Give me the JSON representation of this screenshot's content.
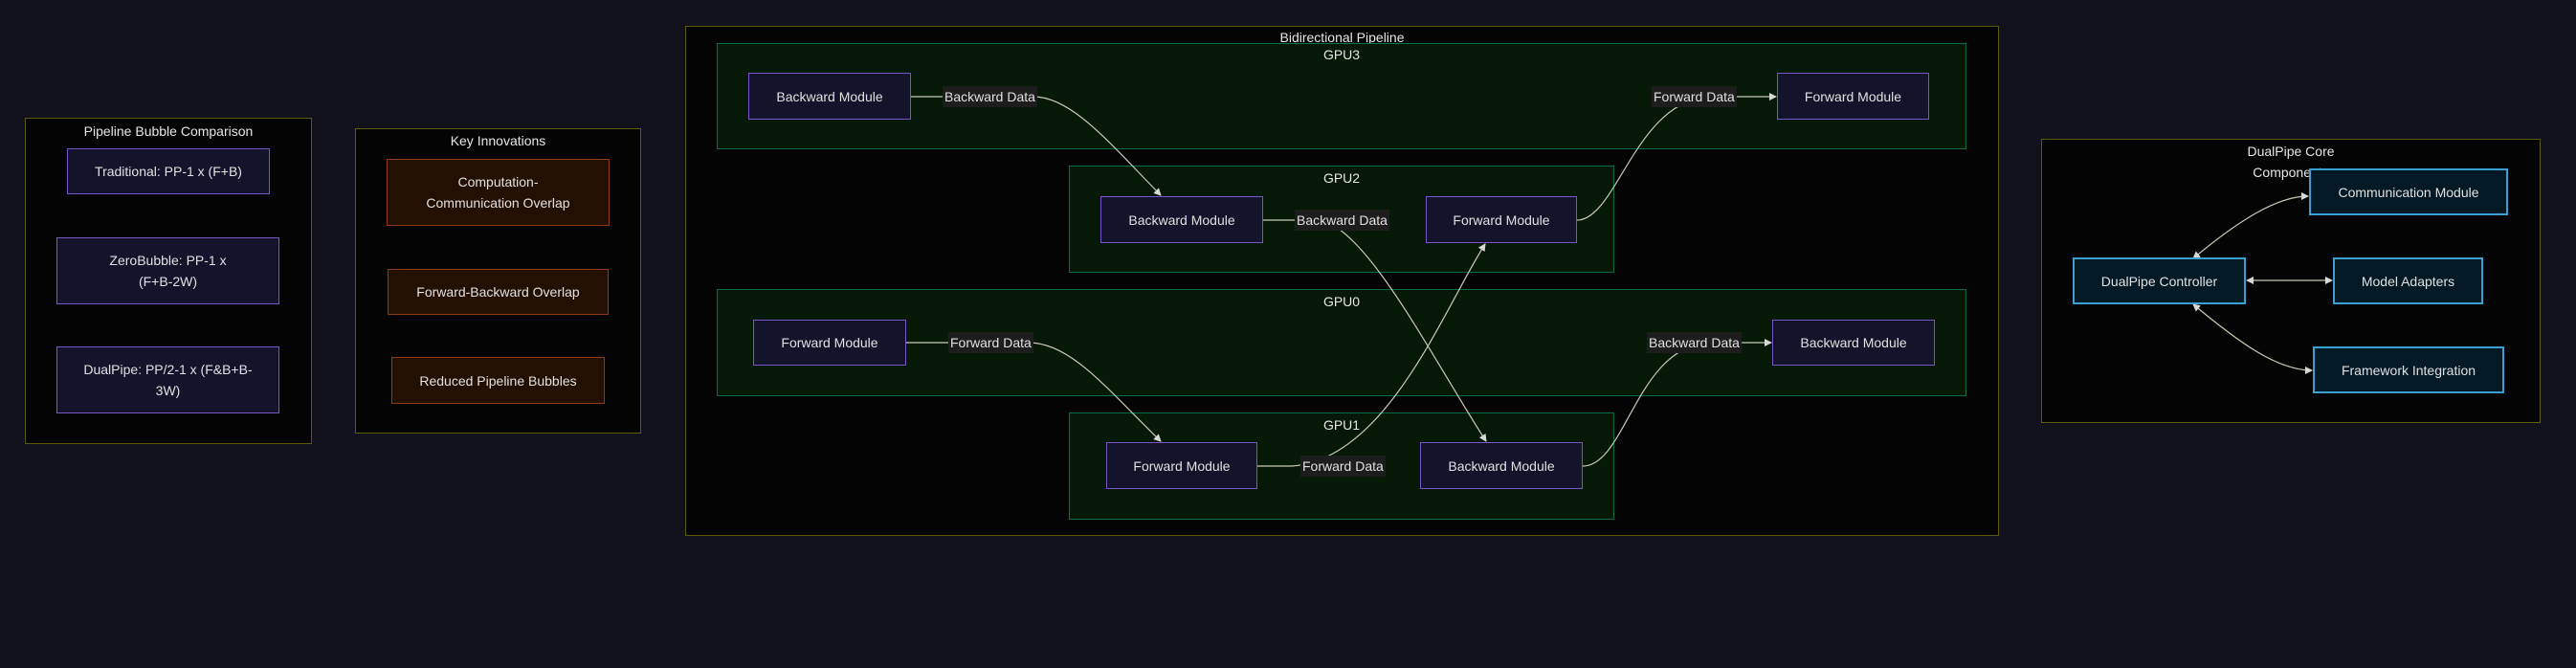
{
  "bubble_panel": {
    "title": "Pipeline Bubble Comparison",
    "items": [
      "Traditional: PP-1 x (F+B)",
      "ZeroBubble: PP-1 x (F+B-2W)",
      "DualPipe: PP/2-1 x (F&B+B-3W)"
    ]
  },
  "innovations_panel": {
    "title": "Key Innovations",
    "items": [
      "Computation-Communication Overlap",
      "Forward-Backward Overlap",
      "Reduced Pipeline Bubbles"
    ]
  },
  "pipeline": {
    "title": "Bidirectional Pipeline",
    "gpu3": {
      "label": "GPU3",
      "left": "Backward Module",
      "right": "Forward Module",
      "edge_left": "Backward Data",
      "edge_right": "Forward Data"
    },
    "gpu2": {
      "label": "GPU2",
      "left": "Backward Module",
      "right": "Forward Module",
      "edge": "Backward Data"
    },
    "gpu0": {
      "label": "GPU0",
      "left": "Forward Module",
      "right": "Backward Module",
      "edge_left": "Forward Data",
      "edge_right": "Backward Data"
    },
    "gpu1": {
      "label": "GPU1",
      "left": "Forward Module",
      "right": "Backward Module",
      "edge": "Forward Data"
    }
  },
  "core_panel": {
    "title": "DualPipe Core Components",
    "controller": "DualPipe Controller",
    "communication": "Communication Module",
    "adapters": "Model Adapters",
    "framework": "Framework Integration"
  },
  "colors": {
    "background": "#11111c",
    "module_border": "#7a55c8",
    "gpu_border": "#0b6a4c",
    "innovation_border": "#8c3a12",
    "core_border": "#3aa0d2",
    "panel_border": "#5b5a0a"
  }
}
